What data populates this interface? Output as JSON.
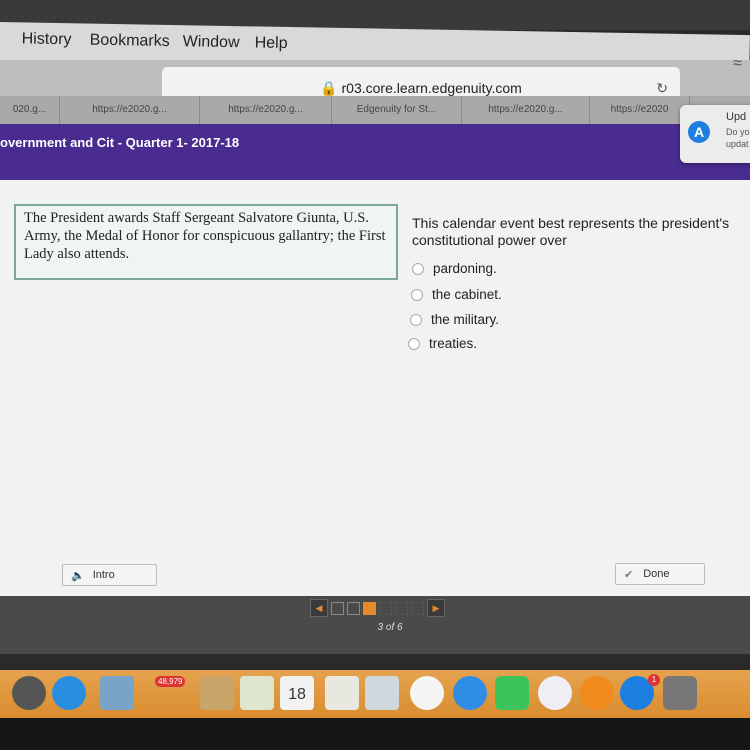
{
  "menubar": {
    "items": [
      "History",
      "Bookmarks",
      "Window",
      "Help"
    ]
  },
  "browser": {
    "url": "r03.core.learn.edgenuity.com",
    "tabs": [
      "020.g...",
      "https://e2020.g...",
      "https://e2020.g...",
      "Edgenuity for St...",
      "https://e2020.g...",
      "https://e2020"
    ]
  },
  "notification": {
    "title": "Upd",
    "line1": "Do yo",
    "line2": "updat"
  },
  "course_title": "overnment and Cit - Quarter 1- 2017-18",
  "passage": "The President awards Staff Sergeant Salvatore Giunta, U.S. Army, the Medal of Honor for conspicuous gallantry; the First Lady also attends.",
  "question": "This calendar event best represents the president's constitutional power over",
  "options": [
    "pardoning.",
    "the cabinet.",
    "the military.",
    "treaties."
  ],
  "buttons": {
    "intro": "Intro",
    "done": "Done"
  },
  "pager": {
    "current": 3,
    "total": 6,
    "label": "3 of 6"
  },
  "dock": {
    "mail_badge": "48,979",
    "calendar_day": "18",
    "appstore_badge": "1"
  },
  "colors": {
    "header": "#4a2b8f",
    "accent": "#e48a2c",
    "dock": "#e0982f"
  }
}
